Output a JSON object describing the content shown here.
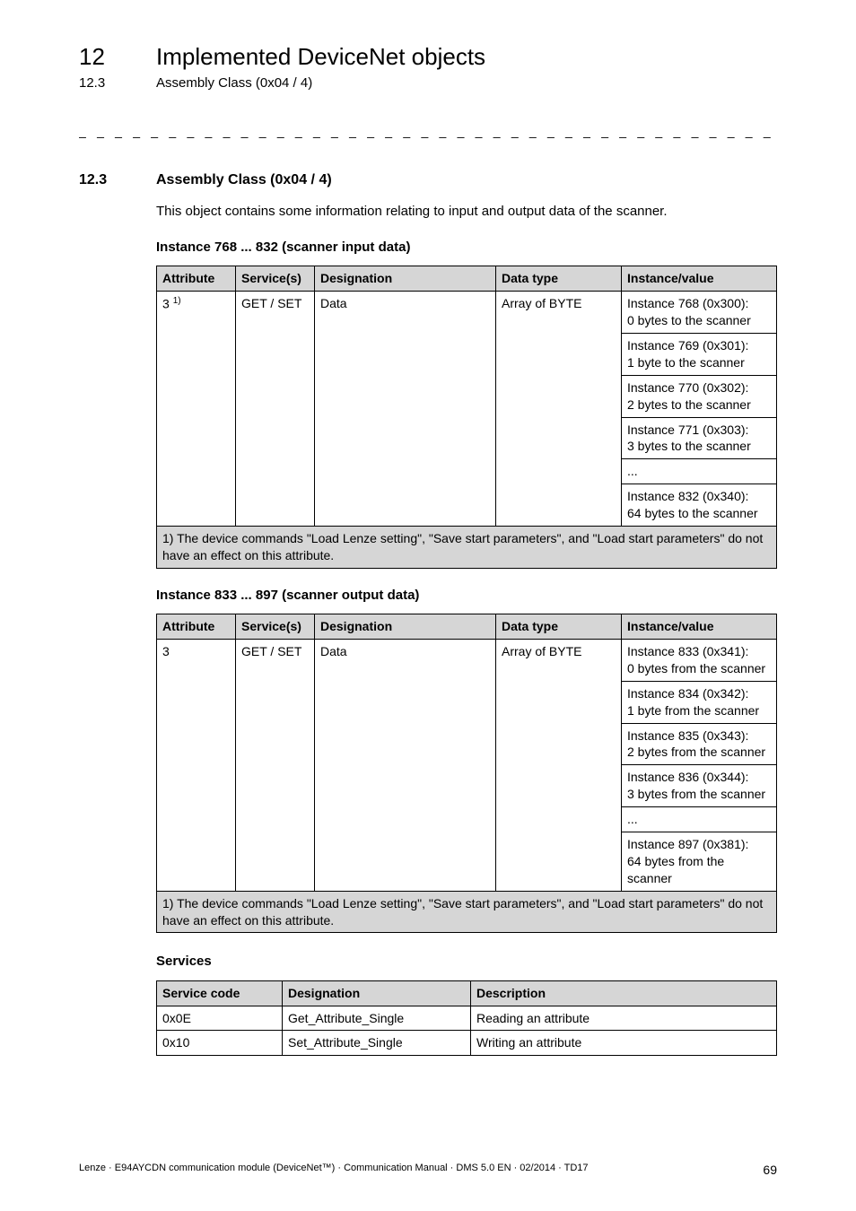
{
  "chapter": {
    "number": "12",
    "title": "Implemented DeviceNet objects"
  },
  "sub": {
    "number": "12.3",
    "title": "Assembly Class (0x04 / 4)"
  },
  "dash_rule": "_ _ _ _ _ _ _ _ _ _ _ _ _ _ _ _ _ _ _ _ _ _ _ _ _ _ _ _ _ _ _ _ _ _ _ _ _ _ _ _ _ _ _ _ _ _ _ _ _ _ _ _ _ _ _ _ _ _ _ _ _ _ _",
  "section": {
    "number": "12.3",
    "title": "Assembly Class (0x04 / 4)"
  },
  "intro_para": "This object contains some information relating to input and output data of the scanner.",
  "table1": {
    "label": "Instance 768 ... 832 (scanner input data)",
    "headers": {
      "attr": "Attribute",
      "serv": "Service(s)",
      "desig": "Designation",
      "dtype": "Data type",
      "inst": "Instance/value"
    },
    "attr_cell": "3",
    "attr_sup": "1)",
    "serv_cell": "GET / SET",
    "desig_cell": "Data",
    "dtype_cell": "Array of BYTE",
    "inst_rows": [
      "Instance 768 (0x300):\n0 bytes to the scanner",
      "Instance 769 (0x301):\n1 byte to the scanner",
      "Instance 770 (0x302):\n2 bytes to the scanner",
      "Instance 771 (0x303):\n3 bytes to the scanner",
      "...",
      "Instance 832 (0x340):\n64 bytes to the scanner"
    ],
    "footnote": "1) The device commands \"Load Lenze setting\", \"Save start parameters\", and \"Load start parameters\" do not have an effect on this attribute."
  },
  "table2": {
    "label": "Instance 833 ... 897 (scanner output data)",
    "headers": {
      "attr": "Attribute",
      "serv": "Service(s)",
      "desig": "Designation",
      "dtype": "Data type",
      "inst": "Instance/value"
    },
    "attr_cell": "3",
    "serv_cell": "GET / SET",
    "desig_cell": "Data",
    "dtype_cell": "Array of BYTE",
    "inst_rows": [
      "Instance 833 (0x341):\n0 bytes from the scanner",
      "Instance 834 (0x342):\n1 byte from the scanner",
      "Instance 835 (0x343):\n2 bytes from the scanner",
      "Instance 836 (0x344):\n3 bytes from the scanner",
      "...",
      "Instance 897 (0x381):\n64 bytes from the scanner"
    ],
    "footnote": "1) The device commands \"Load Lenze setting\", \"Save start parameters\", and \"Load start parameters\" do not have an effect on this attribute."
  },
  "services": {
    "label": "Services",
    "headers": {
      "code": "Service code",
      "desig": "Designation",
      "descr": "Description"
    },
    "rows": [
      {
        "code": "0x0E",
        "desig": "Get_Attribute_Single",
        "descr": "Reading an attribute"
      },
      {
        "code": "0x10",
        "desig": "Set_Attribute_Single",
        "descr": "Writing an attribute"
      }
    ]
  },
  "footer": {
    "left": "Lenze · E94AYCDN communication module (DeviceNet™) · Communication Manual · DMS 5.0 EN · 02/2014 · TD17",
    "page": "69"
  }
}
